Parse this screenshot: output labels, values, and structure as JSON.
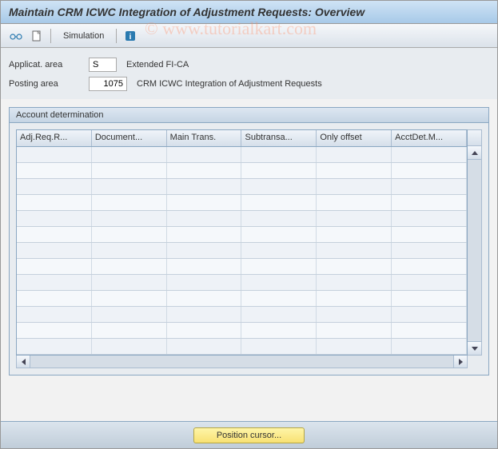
{
  "title": "Maintain CRM ICWC Integration of Adjustment Requests: Overview",
  "watermark": "© www.tutorialkart.com",
  "toolbar": {
    "simulation_label": "Simulation"
  },
  "form": {
    "applicat_area_label": "Applicat. area",
    "applicat_area_value": "S",
    "applicat_area_desc": "Extended FI-CA",
    "posting_area_label": "Posting area",
    "posting_area_value": "1075",
    "posting_area_desc": "CRM ICWC Integration of Adjustment Requests"
  },
  "panel": {
    "header": "Account determination",
    "columns": [
      "Adj.Req.R...",
      "Document...",
      "Main Trans.",
      "Subtransa...",
      "Only offset",
      "AcctDet.M..."
    ],
    "rows": [
      [
        "",
        "",
        "",
        "",
        "",
        ""
      ],
      [
        "",
        "",
        "",
        "",
        "",
        ""
      ],
      [
        "",
        "",
        "",
        "",
        "",
        ""
      ],
      [
        "",
        "",
        "",
        "",
        "",
        ""
      ],
      [
        "",
        "",
        "",
        "",
        "",
        ""
      ],
      [
        "",
        "",
        "",
        "",
        "",
        ""
      ],
      [
        "",
        "",
        "",
        "",
        "",
        ""
      ],
      [
        "",
        "",
        "",
        "",
        "",
        ""
      ],
      [
        "",
        "",
        "",
        "",
        "",
        ""
      ],
      [
        "",
        "",
        "",
        "",
        "",
        ""
      ],
      [
        "",
        "",
        "",
        "",
        "",
        ""
      ],
      [
        "",
        "",
        "",
        "",
        "",
        ""
      ],
      [
        "",
        "",
        "",
        "",
        "",
        ""
      ]
    ]
  },
  "footer": {
    "position_cursor_label": "Position cursor..."
  }
}
